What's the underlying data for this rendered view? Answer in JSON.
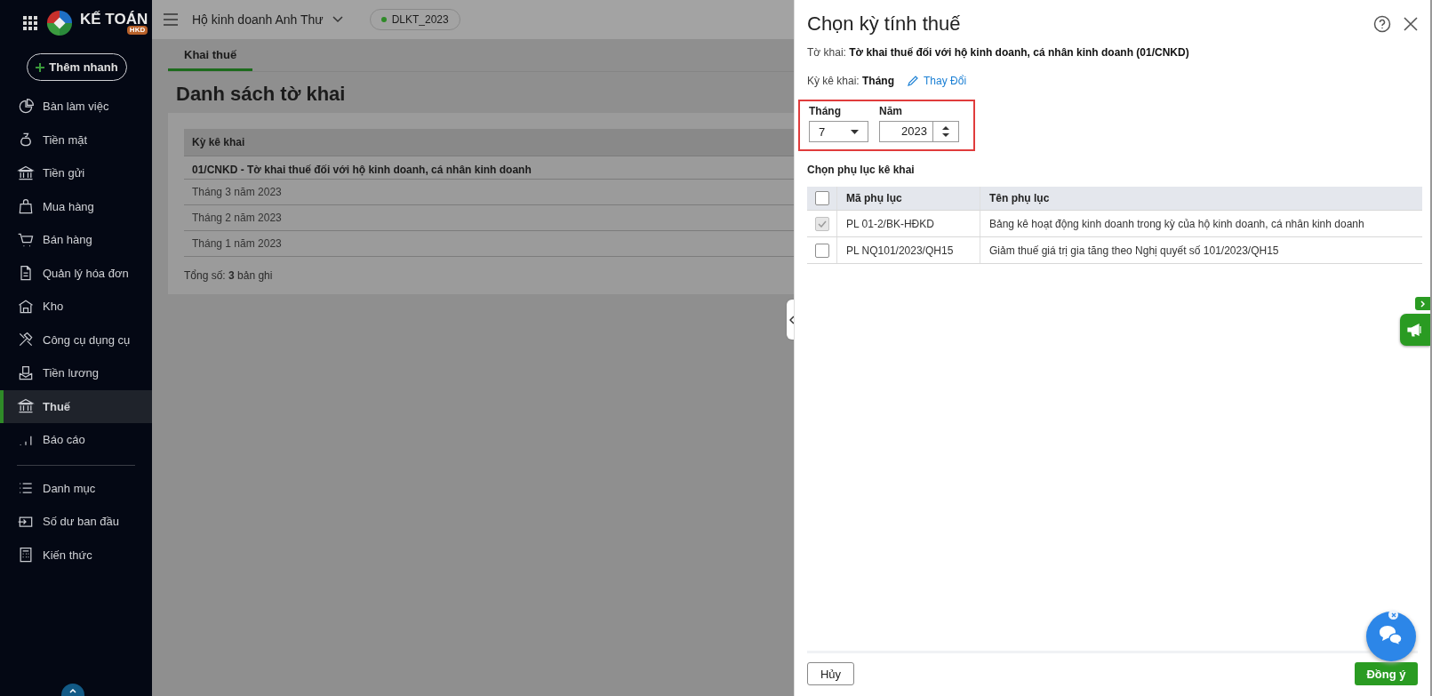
{
  "app": {
    "logo_text": "KẾ TOÁN",
    "logo_badge": "HKD"
  },
  "sidebar": {
    "quick_add": "Thêm nhanh",
    "groups": [
      {
        "items": [
          {
            "label": "Bàn làm việc",
            "selected": false
          },
          {
            "label": "Tiền mặt",
            "selected": false
          },
          {
            "label": "Tiền gửi",
            "selected": false
          },
          {
            "label": "Mua hàng",
            "selected": false
          },
          {
            "label": "Bán hàng",
            "selected": false
          },
          {
            "label": "Quản lý hóa đơn",
            "selected": false
          },
          {
            "label": "Kho",
            "selected": false
          },
          {
            "label": "Công cụ dụng cụ",
            "selected": false
          },
          {
            "label": "Tiền lương",
            "selected": false
          },
          {
            "label": "Thuế",
            "selected": true
          },
          {
            "label": "Báo cáo",
            "selected": false
          }
        ]
      },
      {
        "items": [
          {
            "label": "Danh mục",
            "selected": false
          },
          {
            "label": "Số dư ban đầu",
            "selected": false
          },
          {
            "label": "Kiến thức",
            "selected": false
          }
        ]
      }
    ]
  },
  "header": {
    "company": "Hộ kinh doanh Anh Thư",
    "database": "DLKT_2023"
  },
  "tabs": [
    {
      "label": "Khai thuế",
      "selected": true
    }
  ],
  "page": {
    "title": "Danh sách tờ khai",
    "table": {
      "columns": [
        "Kỳ kê khai"
      ],
      "group_row": "01/CNKD - Tờ khai thuế đối với hộ kinh doanh, cá nhân kinh doanh",
      "rows": [
        "Tháng 3 năm 2023",
        "Tháng 2 năm 2023",
        "Tháng 1 năm 2023"
      ]
    },
    "total": "Tổng số: **3** bản ghi"
  },
  "drawer": {
    "title": "Chọn kỳ tính thuế",
    "declaration_label": "Tờ khai:",
    "declaration_value": "Tờ khai thuế đối với hộ kinh doanh, cá nhân kinh doanh (01/CNKD)",
    "period_label": "Kỳ kê khai:",
    "period_value": "Tháng",
    "change_link": "Thay Đổi",
    "month_label": "Tháng",
    "month_value": "7",
    "year_label": "Năm",
    "year_value": "2023",
    "highlighted": true,
    "appendix_title": "Chọn phụ lục kê khai",
    "appendix_table": {
      "header_checked": false,
      "columns": [
        "Mã phụ lục",
        "Tên phụ lục"
      ],
      "rows": [
        {
          "checked": true,
          "disabled": true,
          "code": "PL 01-2/BK-HĐKD",
          "name": "Bảng kê hoạt động kinh doanh trong kỳ của hộ kinh doanh, cá nhân kinh doanh"
        },
        {
          "checked": false,
          "disabled": false,
          "code": "PL NQ101/2023/QH15",
          "name": "Giảm thuế giá trị gia tăng theo Nghị quyết số 101/2023/QH15"
        }
      ]
    },
    "cancel_button": "Hủy",
    "ok_button": "Đồng ý"
  }
}
